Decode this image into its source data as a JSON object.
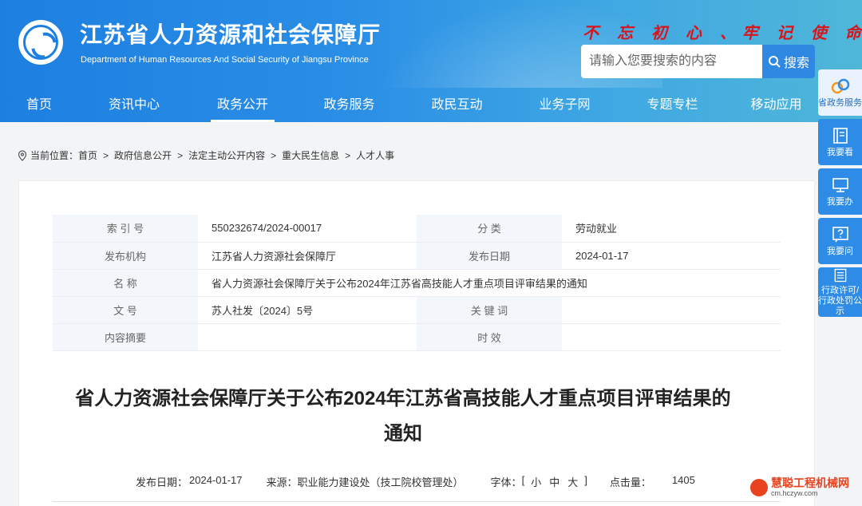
{
  "header": {
    "title": "江苏省人力资源和社会保障厅",
    "subtitle": "Department of Human Resources And Social Security of Jiangsu Province",
    "slogan": "不 忘 初 心  、牢 记 使 命",
    "search_placeholder": "请输入您要搜索的内容",
    "search_label": "搜索"
  },
  "nav": [
    "首页",
    "资讯中心",
    "政务公开",
    "政务服务",
    "政民互动",
    "业务子网",
    "专题专栏",
    "移动应用"
  ],
  "breadcrumb": {
    "prefix": "当前位置：",
    "items": [
      "首页",
      "政府信息公开",
      "法定主动公开内容",
      "重大民生信息",
      "人才人事"
    ],
    "sep": ">"
  },
  "meta": {
    "index_label": "索 引 号",
    "index_value": "550232674/2024-00017",
    "category_label": "分 类",
    "category_value": "劳动就业",
    "publisher_label": "发布机构",
    "publisher_value": "江苏省人力资源社会保障厅",
    "pubdate_label": "发布日期",
    "pubdate_value": "2024-01-17",
    "name_label": "名 称",
    "name_value": "省人力资源社会保障厅关于公布2024年江苏省高技能人才重点项目评审结果的通知",
    "docno_label": "文 号",
    "docno_value": "苏人社发〔2024〕5号",
    "keyword_label": "关 键 词",
    "keyword_value": "",
    "abstract_label": "内容摘要",
    "abstract_value": "",
    "validity_label": "时 效",
    "validity_value": ""
  },
  "article": {
    "title_line1": "省人力资源社会保障厅关于公布2024年江苏省高技能人才重点项目评审结果的",
    "title_line2": "通知",
    "date_label": "发布日期：",
    "date_value": "2024-01-17",
    "source_label": "来源：",
    "source_value": "职业能力建设处（技工院校管理处）",
    "font_label": "字体：",
    "font_open": "[",
    "font_small": "小",
    "font_medium": "中",
    "font_large": "大",
    "font_close": "]",
    "clicks_label": "点击量：",
    "clicks_value": "1405"
  },
  "side": {
    "gov_service": "省政务服务",
    "read": "我要看",
    "do": "我要办",
    "ask": "我要问",
    "notice": "行政许可/行政处罚公示"
  },
  "watermark": {
    "name": "慧聪工程机械网",
    "url": "cm.hczyw.com"
  },
  "colors": {
    "header_blue": "#1d7fe0",
    "slogan_red": "#d8141b",
    "side_blue": "#2e8be6"
  }
}
